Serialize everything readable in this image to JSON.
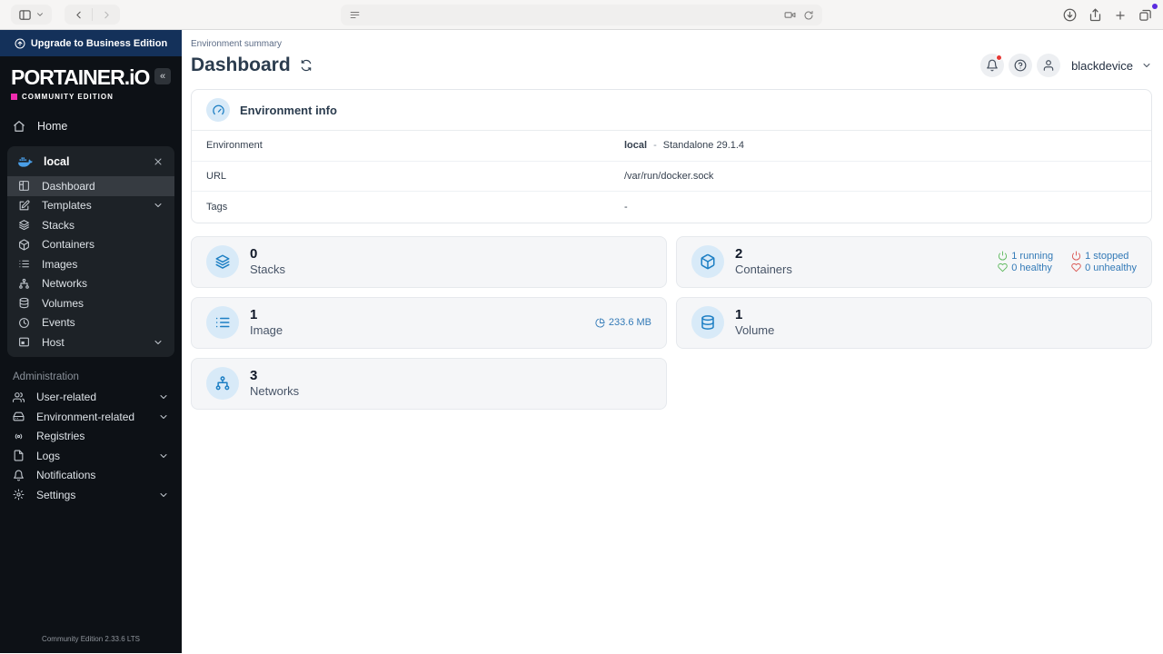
{
  "browser": {
    "url": "",
    "left_icons": [
      "sidebar-toggle-icon",
      "chevron-down-icon",
      "back-icon",
      "forward-icon"
    ],
    "address_icons": [
      "reader-icon",
      "privacy-camera-icon",
      "reload-icon"
    ],
    "right_icons": [
      "downloads-icon",
      "share-icon",
      "new-tab-icon",
      "tab-overview-icon"
    ]
  },
  "sidebar": {
    "upgrade_banner": "Upgrade to Business Edition",
    "logo": "PORTAINER.iO",
    "edition": "COMMUNITY EDITION",
    "collapse_label": "«",
    "home_label": "Home",
    "environment": {
      "name": "local",
      "items": [
        {
          "label": "Dashboard",
          "icon": "dashboard-icon",
          "active": true
        },
        {
          "label": "Templates",
          "icon": "templates-icon",
          "chevron": true
        },
        {
          "label": "Stacks",
          "icon": "stacks-icon"
        },
        {
          "label": "Containers",
          "icon": "containers-icon"
        },
        {
          "label": "Images",
          "icon": "images-icon"
        },
        {
          "label": "Networks",
          "icon": "networks-icon"
        },
        {
          "label": "Volumes",
          "icon": "volumes-icon"
        },
        {
          "label": "Events",
          "icon": "events-icon"
        },
        {
          "label": "Host",
          "icon": "host-icon",
          "chevron": true
        }
      ]
    },
    "admin": {
      "title": "Administration",
      "items": [
        {
          "label": "User-related",
          "icon": "users-icon",
          "chevron": true
        },
        {
          "label": "Environment-related",
          "icon": "hard-drive-icon",
          "chevron": true
        },
        {
          "label": "Registries",
          "icon": "registry-icon"
        },
        {
          "label": "Logs",
          "icon": "logs-icon",
          "chevron": true
        },
        {
          "label": "Notifications",
          "icon": "bell-icon"
        },
        {
          "label": "Settings",
          "icon": "settings-icon",
          "chevron": true
        }
      ]
    },
    "footer": "Community Edition 2.33.6 LTS"
  },
  "header": {
    "breadcrumb": "Environment summary",
    "title": "Dashboard",
    "username": "blackdevice"
  },
  "env_info": {
    "title": "Environment info",
    "rows": {
      "environment": {
        "label": "Environment",
        "name": "local",
        "sep": "-",
        "detail": "Standalone 29.1.4"
      },
      "url": {
        "label": "URL",
        "value": "/var/run/docker.sock"
      },
      "tags": {
        "label": "Tags",
        "value": "-"
      }
    }
  },
  "cards": {
    "stacks": {
      "count": "0",
      "label": "Stacks"
    },
    "containers": {
      "count": "2",
      "label": "Containers",
      "stats": [
        {
          "text": "1 running",
          "icon": "power-icon",
          "status": "green"
        },
        {
          "text": "1 stopped",
          "icon": "power-icon",
          "status": "red"
        },
        {
          "text": "0 healthy",
          "icon": "heart-icon",
          "status": "green"
        },
        {
          "text": "0 unhealthy",
          "icon": "heart-icon",
          "status": "red"
        }
      ]
    },
    "image": {
      "count": "1",
      "label": "Image",
      "size": "233.6 MB",
      "size_icon": "pie-chart-icon"
    },
    "volume": {
      "count": "1",
      "label": "Volume"
    },
    "networks": {
      "count": "3",
      "label": "Networks"
    }
  },
  "colors": {
    "accent_blue": "#337ab7",
    "icon_blue": "#1d7fc4",
    "banner_navy": "#14315a",
    "brand_magenta": "#ee2bad",
    "status_green": "#5cb85c",
    "status_red": "#d9534f",
    "sidebar_bg": "#0d1116"
  }
}
